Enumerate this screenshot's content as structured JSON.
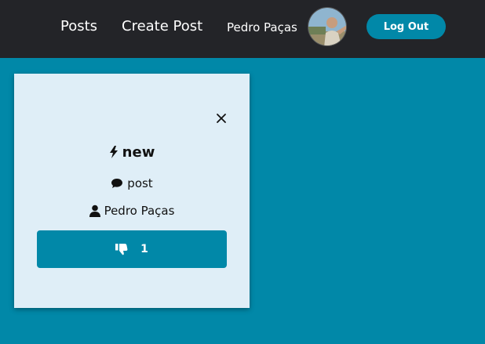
{
  "nav": {
    "posts_label": "Posts",
    "create_post_label": "Create Post",
    "user_name": "Pedro Paças",
    "logout_label": "Log Out"
  },
  "post": {
    "title": "new",
    "content": "post",
    "author": "Pedro Paças",
    "dislike_count": "1"
  },
  "icons": {
    "close": "close-icon",
    "title": "bolt-icon",
    "content": "comment-icon",
    "author": "user-icon",
    "dislike": "thumbs-down-icon"
  },
  "colors": {
    "background": "#0188a8",
    "navbar": "#232428",
    "card": "#dfeef7",
    "button": "#0188a8"
  }
}
